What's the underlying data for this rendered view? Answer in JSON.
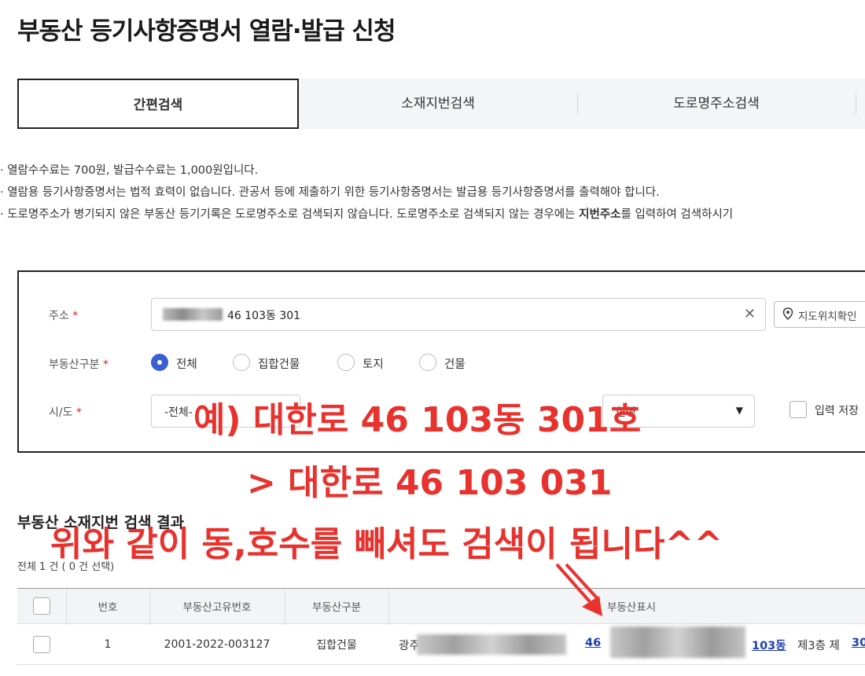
{
  "page": {
    "title": "부동산 등기사항증명서 열람·발급 신청"
  },
  "tabs": [
    {
      "label": "간편검색",
      "active": true
    },
    {
      "label": "소재지번검색",
      "active": false
    },
    {
      "label": "도로명주소검색",
      "active": false
    }
  ],
  "notices": [
    "· 열람수수료는  700원, 발급수수료는  1,000원입니다.",
    "· 열람용 등기사항증명서는 법적 효력이 없습니다. 관공서 등에 제출하기 위한 등기사항증명서는 발급용 등기사항증명서를 출력해야 합니다.",
    {
      "before": "· 도로명주소가 병기되지 않은 부동산 등기기록은 도로명주소로 검색되지 않습니다. 도로명주소로 검색되지 않는 경우에는 ",
      "bold": "지번주소",
      "after": "를 입력하여 검색하시기"
    }
  ],
  "form": {
    "address_label": "주소",
    "required_mark": "*",
    "address_value": "46 103동 301",
    "clear_icon": "close-icon",
    "map_button": "지도위치확인",
    "type_label": "부동산구분",
    "type_options": [
      {
        "label": "전체",
        "selected": true
      },
      {
        "label": "집합건물",
        "selected": false
      },
      {
        "label": "토지",
        "selected": false
      },
      {
        "label": "건물",
        "selected": false
      }
    ],
    "sido_label": "시/도",
    "sido_value": "-전체-",
    "registry_select_value": "현행",
    "save_input_label": "입력 저장"
  },
  "results": {
    "title": "부동산 소재지번 검색 결과",
    "count_text": "전체 1 건 ( 0 건 선택)",
    "columns": [
      "번호",
      "부동산고유번호",
      "부동산구분",
      "부동산표시"
    ],
    "rows": [
      {
        "no": "1",
        "unique_no": "2001-2022-003127",
        "type": "집합건물",
        "prefix": "광주",
        "lot_no": "46",
        "dong": "103동",
        "floor_text": "제3층 제",
        "ho": "30"
      }
    ]
  },
  "annotation": {
    "line1": "예) 대한로 46 103동 301호",
    "line2": "> 대한로 46 103 031",
    "line3": "위와 같이 동,호수를 빼셔도 검색이 됩니다^^",
    "color": "#e8322e"
  }
}
